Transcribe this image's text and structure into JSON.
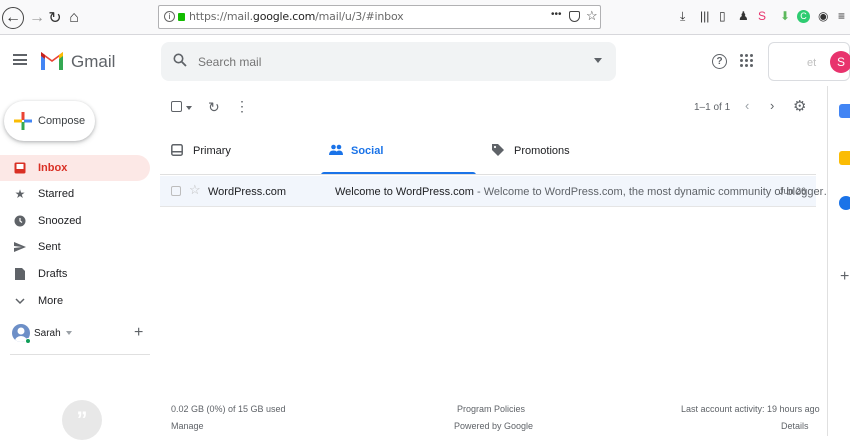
{
  "browser": {
    "url_prefix": "https://mail.",
    "url_domain": "google.com",
    "url_path": "/mail/u/3/#inbox",
    "more_label": "•••"
  },
  "header": {
    "app_name": "Gmail",
    "search_placeholder": "Search mail",
    "account_initial": "S",
    "account_faint": "et",
    "help_label": "?"
  },
  "sidebar": {
    "compose_label": "Compose",
    "items": [
      {
        "label": "Inbox",
        "icon": "inbox-icon",
        "active": true
      },
      {
        "label": "Starred",
        "icon": "star-icon"
      },
      {
        "label": "Snoozed",
        "icon": "clock-icon"
      },
      {
        "label": "Sent",
        "icon": "send-icon"
      },
      {
        "label": "Drafts",
        "icon": "draft-icon"
      },
      {
        "label": "More",
        "icon": "chevron-down-icon"
      }
    ],
    "account_name": "Sarah",
    "hangouts_glyph": "”"
  },
  "toolbar": {
    "pager": "1–1 of 1"
  },
  "tabs": [
    {
      "label": "Primary",
      "icon": "inbox-icon"
    },
    {
      "label": "Social",
      "icon": "people-icon",
      "active": true
    },
    {
      "label": "Promotions",
      "icon": "tag-icon"
    }
  ],
  "emails": [
    {
      "sender": "WordPress.com",
      "subject": "Welcome to WordPress.com",
      "snippet": " - Welcome to WordPress.com, the most dynamic community of blogger…",
      "date": "Jun 26"
    }
  ],
  "footer": {
    "storage": "0.02 GB (0%) of 15 GB used",
    "manage": "Manage",
    "policies": "Program Policies",
    "powered": "Powered by Google",
    "activity": "Last account activity: 19 hours ago",
    "details": "Details"
  },
  "colors": {
    "accent": "#1a73e8",
    "inbox_active_bg": "#fce8e6",
    "inbox_active_text": "#d93025",
    "avatar": "#e8336d"
  }
}
